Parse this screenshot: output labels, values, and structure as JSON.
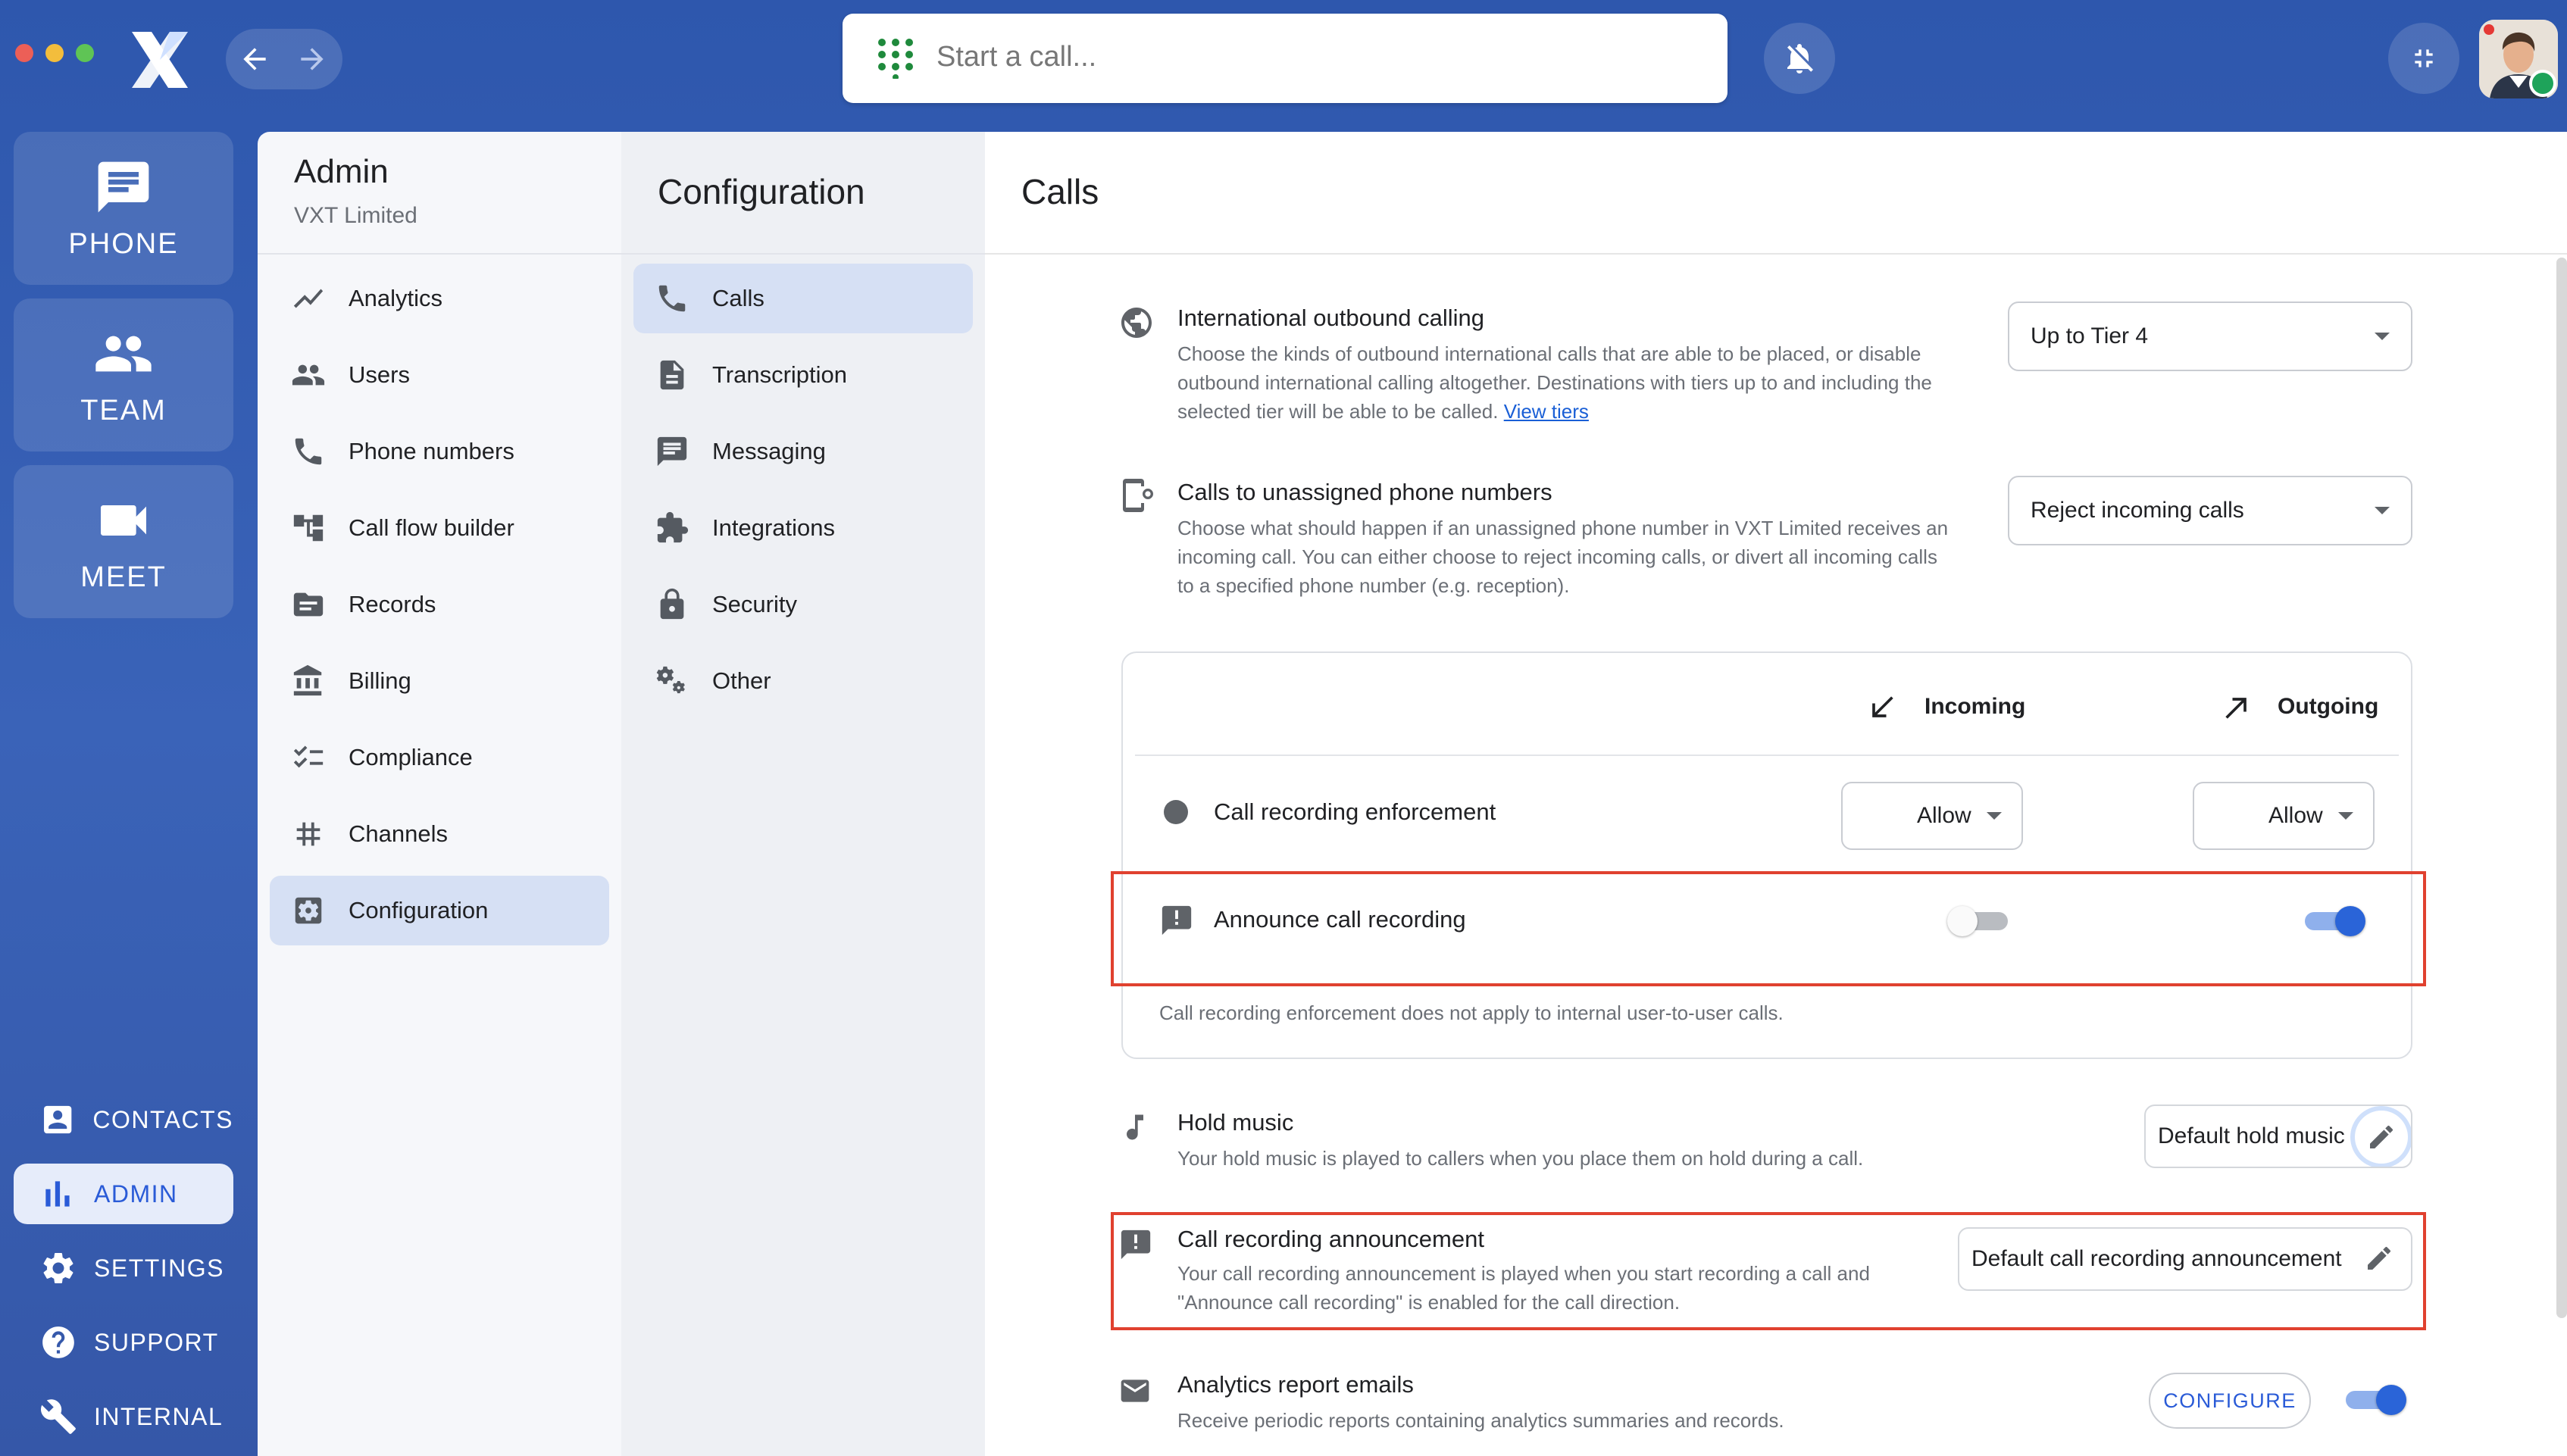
{
  "window": {
    "search_placeholder": "Start a call..."
  },
  "rail": {
    "tiles": [
      {
        "label": "PHONE",
        "icon": "chat-icon"
      },
      {
        "label": "TEAM",
        "icon": "team-icon"
      },
      {
        "label": "MEET",
        "icon": "video-icon"
      }
    ],
    "links": [
      {
        "label": "CONTACTS",
        "icon": "contacts-icon"
      },
      {
        "label": "ADMIN",
        "icon": "bar-chart-icon",
        "active": true
      },
      {
        "label": "SETTINGS",
        "icon": "gear-icon"
      },
      {
        "label": "SUPPORT",
        "icon": "help-icon"
      },
      {
        "label": "INTERNAL",
        "icon": "wrench-icon"
      }
    ]
  },
  "admin": {
    "title": "Admin",
    "org": "VXT Limited",
    "items": [
      {
        "label": "Analytics",
        "icon": "trending-icon"
      },
      {
        "label": "Users",
        "icon": "users-icon"
      },
      {
        "label": "Phone numbers",
        "icon": "phone-icon"
      },
      {
        "label": "Call flow builder",
        "icon": "flow-icon"
      },
      {
        "label": "Records",
        "icon": "folder-icon"
      },
      {
        "label": "Billing",
        "icon": "bank-icon"
      },
      {
        "label": "Compliance",
        "icon": "checklist-icon"
      },
      {
        "label": "Channels",
        "icon": "hash-icon"
      },
      {
        "label": "Configuration",
        "icon": "settings-box-icon",
        "active": true
      }
    ]
  },
  "configuration": {
    "title": "Configuration",
    "items": [
      {
        "label": "Calls",
        "icon": "phone-icon",
        "active": true
      },
      {
        "label": "Transcription",
        "icon": "document-icon"
      },
      {
        "label": "Messaging",
        "icon": "message-icon"
      },
      {
        "label": "Integrations",
        "icon": "puzzle-icon"
      },
      {
        "label": "Security",
        "icon": "lock-icon"
      },
      {
        "label": "Other",
        "icon": "gears-icon"
      }
    ]
  },
  "calls": {
    "title": "Calls",
    "international": {
      "title": "International outbound calling",
      "desc_line1": "Choose the kinds of outbound international calls that are able to be placed, or disable",
      "desc_line2": "outbound international calling altogether. Destinations with tiers up to and including the",
      "desc_line3": "selected tier will be able to be called.",
      "link": "View tiers",
      "value": "Up to Tier 4"
    },
    "unassigned": {
      "title": "Calls to unassigned phone numbers",
      "desc_line1": "Choose what should happen if an unassigned phone number in VXT Limited receives an",
      "desc_line2": "incoming call. You can either choose to reject incoming calls, or divert all incoming calls",
      "desc_line3": "to a specified phone number (e.g. reception).",
      "value": "Reject incoming calls"
    },
    "recording": {
      "incoming_label": "Incoming",
      "outgoing_label": "Outgoing",
      "enforcement_label": "Call recording enforcement",
      "enforcement_incoming": "Allow",
      "enforcement_outgoing": "Allow",
      "announce_label": "Announce call recording",
      "announce_incoming": false,
      "announce_outgoing": true,
      "footnote": "Call recording enforcement does not apply to internal user-to-user calls."
    },
    "hold_music": {
      "title": "Hold music",
      "desc": "Your hold music is played to callers when you place them on hold during a call.",
      "value": "Default hold music"
    },
    "announcement": {
      "title": "Call recording announcement",
      "desc_line1": "Your call recording announcement is played when you start recording a call and",
      "desc_line2": "\"Announce call recording\" is enabled for the call direction.",
      "value": "Default call recording announcement"
    },
    "analytics": {
      "title": "Analytics report emails",
      "desc": "Receive periodic reports containing analytics summaries and records.",
      "button": "CONFIGURE",
      "enabled": true
    }
  },
  "colors": {
    "accent": "#2a64d8",
    "highlight": "#e0412f",
    "background": "#3a63b8"
  }
}
